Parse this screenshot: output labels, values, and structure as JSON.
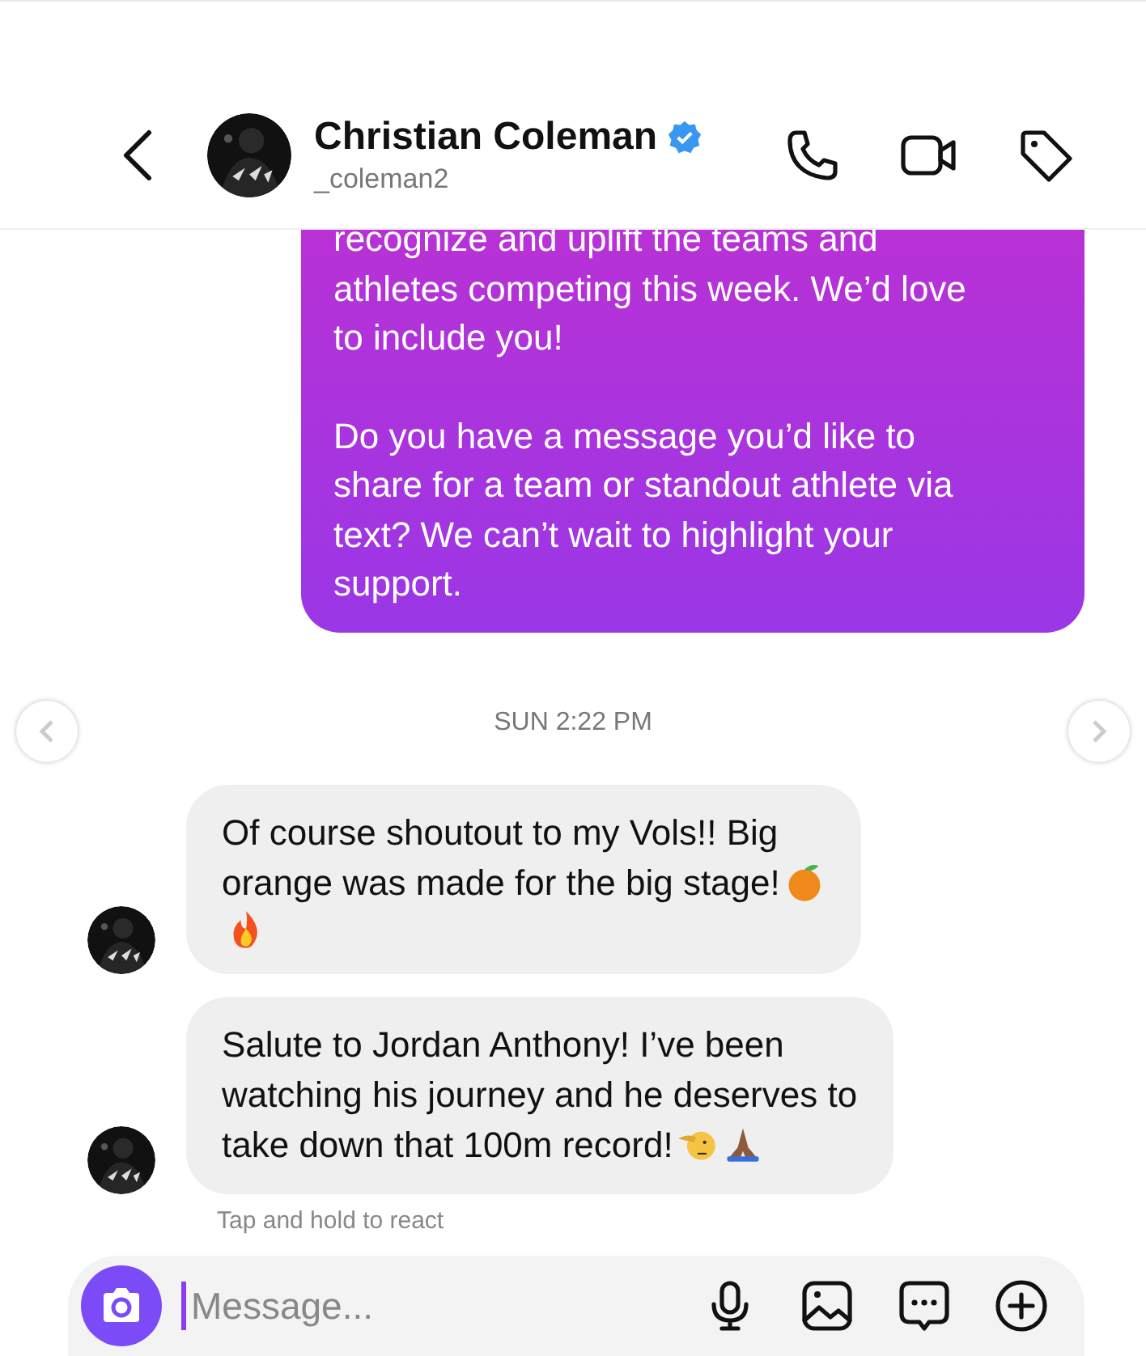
{
  "header": {
    "name": "Christian Coleman",
    "verified": true,
    "username": "_coleman2"
  },
  "messages": [
    {
      "kind": "outgoing",
      "paragraphs": [
        [
          "recognize and uplift the teams and",
          "athletes competing this week. We’d love",
          "to include you!"
        ],
        [
          "Do you have a message you’d like to",
          "share for a team or standout athlete via",
          "text? We can’t wait to highlight your",
          "support."
        ]
      ]
    },
    {
      "kind": "timestamp",
      "text": "SUN 2:22 PM"
    },
    {
      "kind": "incoming",
      "lines": [
        "Of course shoutout to my Vols!! Big",
        "orange was made for the big stage!"
      ]
    },
    {
      "kind": "incoming",
      "lines": [
        "Salute to Jordan Anthony! I’ve been",
        "watching his journey and he deserves to",
        "take down that 100m record!"
      ]
    }
  ],
  "hint": "Tap and hold to react",
  "composer": {
    "placeholder": "Message..."
  }
}
